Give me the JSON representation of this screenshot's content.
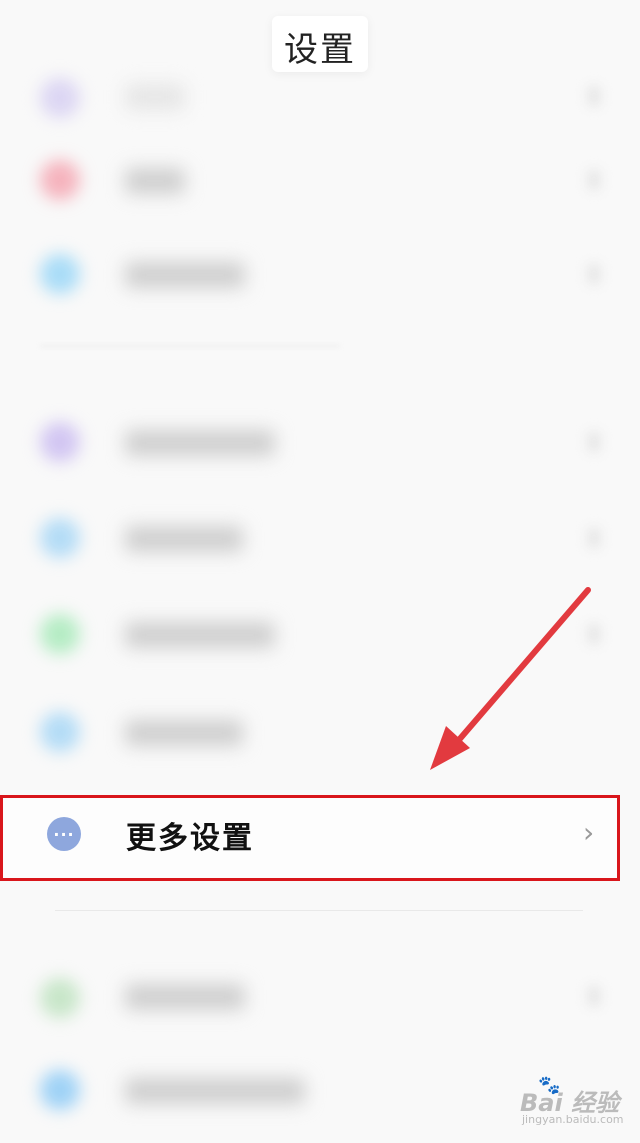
{
  "header": {
    "title": "设置"
  },
  "highlighted_item": {
    "label": "更多设置",
    "icon": "more-dots-icon",
    "icon_glyph": "···",
    "chevron": "›",
    "icon_color": "#8ea7dd",
    "highlight_color": "#d9161c"
  },
  "annotation": {
    "arrow_color": "#e23a3f"
  },
  "watermark": {
    "main": "Bai 经验",
    "sub": "jingyan.baidu.com"
  },
  "colors": {
    "background": "#f9f9f9",
    "blurred_icon_colors": [
      "#dcd6f3",
      "#f5b3bd",
      "#a9dcf7",
      "#d2c6f2",
      "#b4dcf6",
      "#b5ecc4",
      "#b4dcf6",
      "#c8e6c9",
      "#9fd2f6"
    ]
  }
}
